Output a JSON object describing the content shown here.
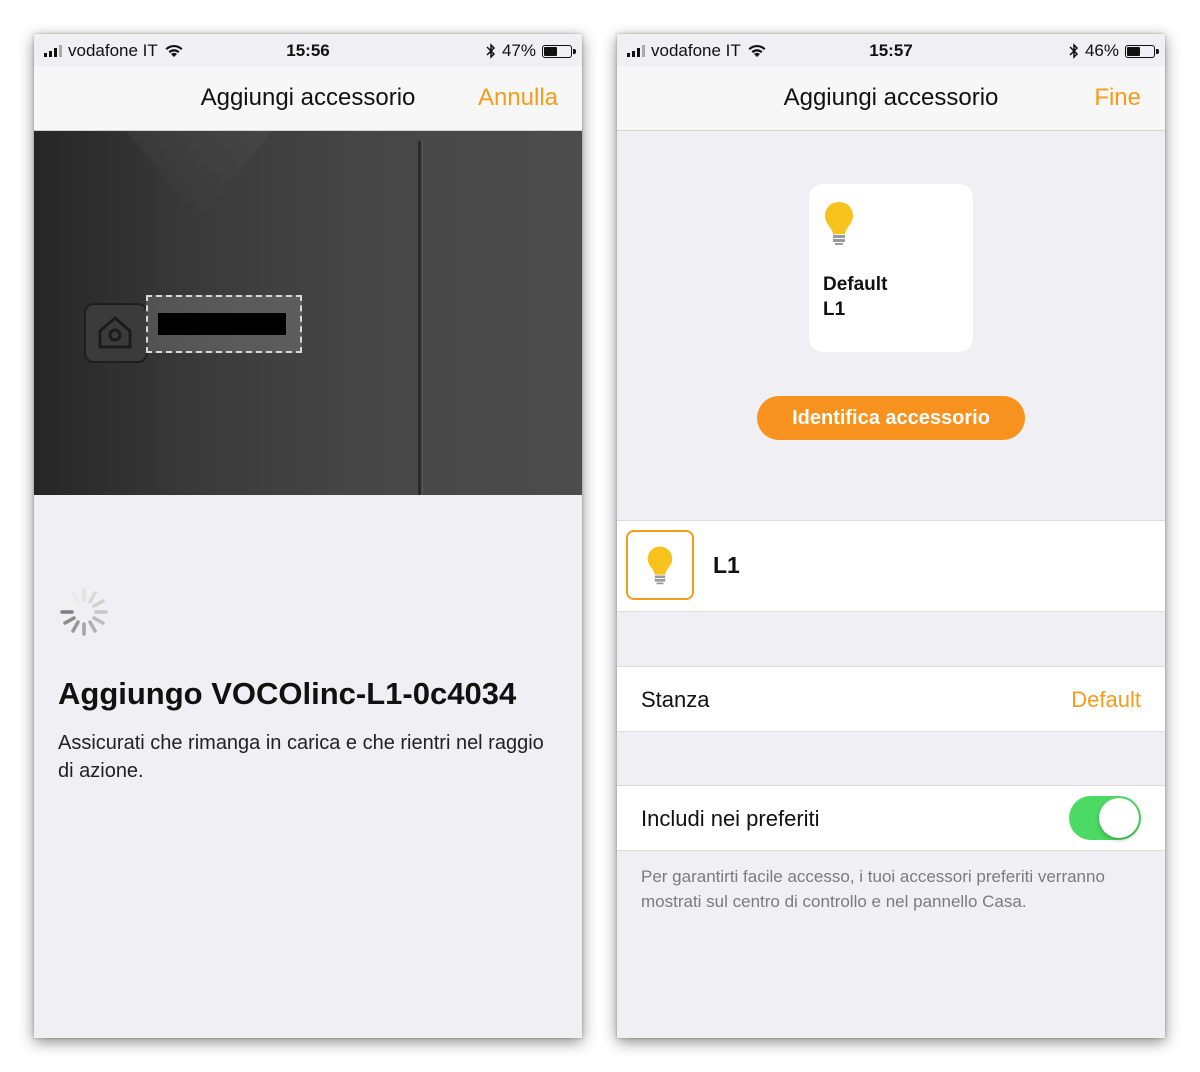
{
  "colors": {
    "accent": "#f59c1a",
    "toggle_on": "#4cd964",
    "bulb": "#f7c21c"
  },
  "left_screen": {
    "status": {
      "carrier": "vodafone IT",
      "time": "15:56",
      "battery": "47%",
      "battery_level": 0.47
    },
    "nav": {
      "title": "Aggiungi accessorio",
      "action": "Annulla"
    },
    "camera": {
      "icons": [
        "home-tag-icon"
      ]
    },
    "progress": {
      "title": "Aggiungo VOCOlinc-L1-0c4034",
      "description": "Assicurati che rimanga in carica e che rientri nel raggio di azione."
    }
  },
  "right_screen": {
    "status": {
      "carrier": "vodafone IT",
      "time": "15:57",
      "battery": "46%",
      "battery_level": 0.46
    },
    "nav": {
      "title": "Aggiungi accessorio",
      "action": "Fine"
    },
    "accessory_card": {
      "room": "Default",
      "name": "L1",
      "icon": "lightbulb-icon"
    },
    "identify_button": "Identifica accessorio",
    "accessory_row": {
      "label": "L1",
      "icon": "lightbulb-icon"
    },
    "room_row": {
      "label": "Stanza",
      "value": "Default"
    },
    "favorites_row": {
      "label": "Includi nei preferiti",
      "enabled": true
    },
    "favorites_footnote": "Per garantirti facile accesso, i tuoi accessori preferiti verranno mostrati sul centro di controllo e nel pannello Casa."
  }
}
